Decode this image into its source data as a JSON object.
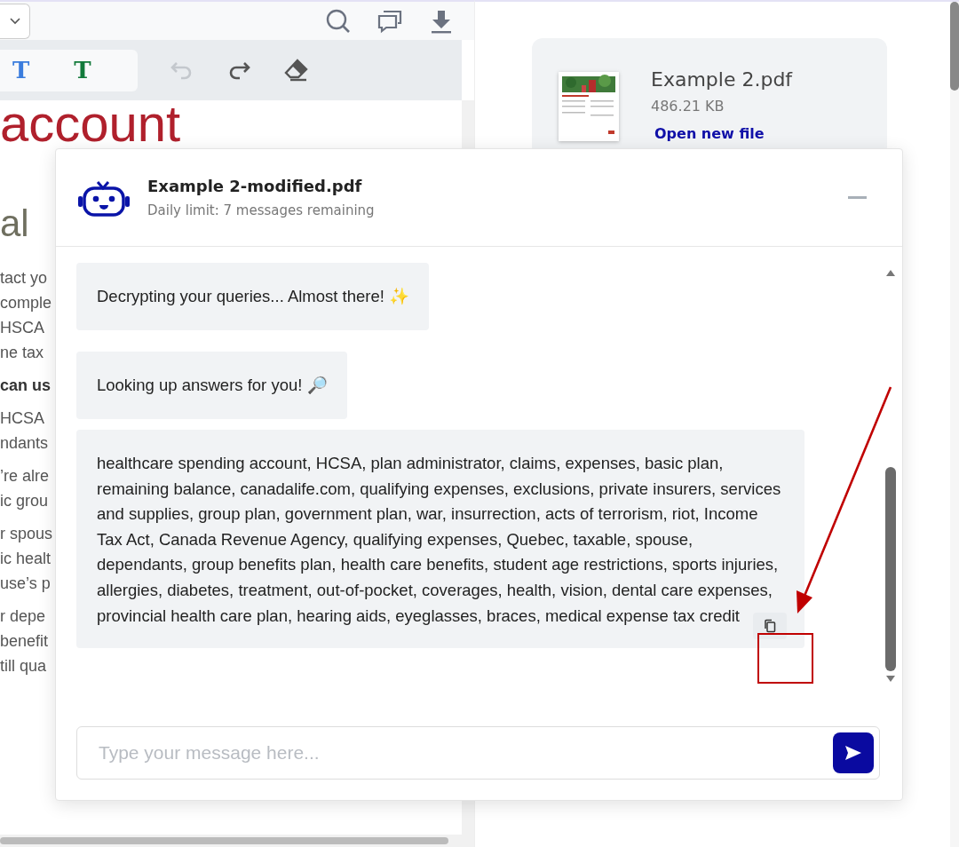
{
  "toolbar": {
    "annotation_tools": [
      {
        "label": "T",
        "color": "#3b7ddd"
      },
      {
        "label": "T",
        "color": "#127a3a"
      }
    ],
    "history": [
      {
        "kind": "undo",
        "disabled": true
      },
      {
        "kind": "redo",
        "disabled": false
      }
    ]
  },
  "document": {
    "heading": "account",
    "subheading": "al",
    "paragraphs": [
      {
        "bold": false,
        "lines": [
          "tact yo",
          "comple",
          "HSCA",
          "ne tax"
        ]
      },
      {
        "bold": true,
        "lines": [
          "can us"
        ]
      },
      {
        "bold": false,
        "lines": [
          "HCSA",
          "ndants"
        ]
      },
      {
        "bold": false,
        "lines": [
          "’re alre",
          "ic grou"
        ]
      },
      {
        "bold": false,
        "lines": [
          "r spous",
          "ic healt",
          "use’s p"
        ]
      },
      {
        "bold": false,
        "lines": [
          "r depe",
          "benefit",
          "till qua"
        ]
      }
    ]
  },
  "file_card": {
    "name": "Example 2.pdf",
    "size": "486.21 KB",
    "link": "Open new file"
  },
  "chat": {
    "title": "Example 2-modified.pdf",
    "subtitle": "Daily limit: 7 messages remaining",
    "messages": [
      {
        "text": "Decrypting your queries... Almost there! ✨",
        "copyable": false
      },
      {
        "text": "Looking up answers for you! 🔎",
        "copyable": false
      },
      {
        "text": "healthcare spending account, HCSA, plan administrator, claims, expenses, basic plan, remaining balance, canadalife.com, qualifying expenses, exclusions, private insurers, services and supplies, group plan, government plan, war, insurrection, acts of terrorism, riot, Income Tax Act, Canada Revenue Agency, qualifying expenses, Quebec, taxable, spouse, dependants, group benefits plan, health care benefits, student age restrictions, sports injuries, allergies, diabetes, treatment, out-of-pocket, coverages, health, vision, dental care expenses, provincial health care plan, hearing aids, eyeglasses, braces, medical expense tax credit",
        "copyable": true
      }
    ],
    "input": {
      "placeholder": "Type your message here..."
    }
  }
}
